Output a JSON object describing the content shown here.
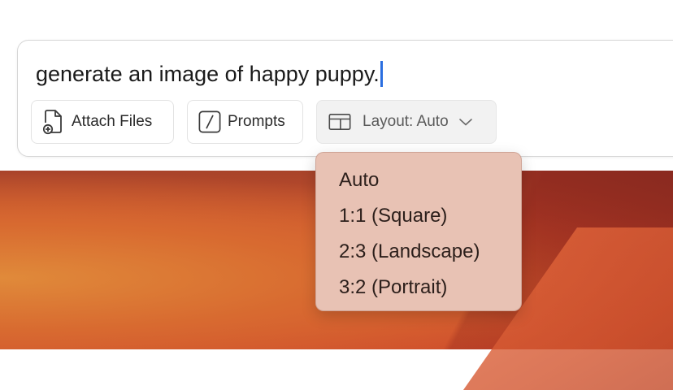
{
  "composer": {
    "prompt_text": "generate an image of happy puppy."
  },
  "toolbar": {
    "attach_label": "Attach Files",
    "attach_icon": "attach-file-icon",
    "prompts_label": "Prompts",
    "prompts_icon": "prompts-icon",
    "layout_label": "Layout: Auto",
    "layout_icon": "layout-icon",
    "layout_chevron_icon": "chevron-down-icon"
  },
  "layout_menu": {
    "items": [
      {
        "label": "Auto"
      },
      {
        "label": "1:1 (Square)"
      },
      {
        "label": "2:3 (Landscape)"
      },
      {
        "label": "3:2 (Portrait)"
      }
    ]
  },
  "colors": {
    "caret": "#2a6ee0",
    "dropdown_bg": "#e8c2b4",
    "wallpaper": "#d65a30"
  }
}
